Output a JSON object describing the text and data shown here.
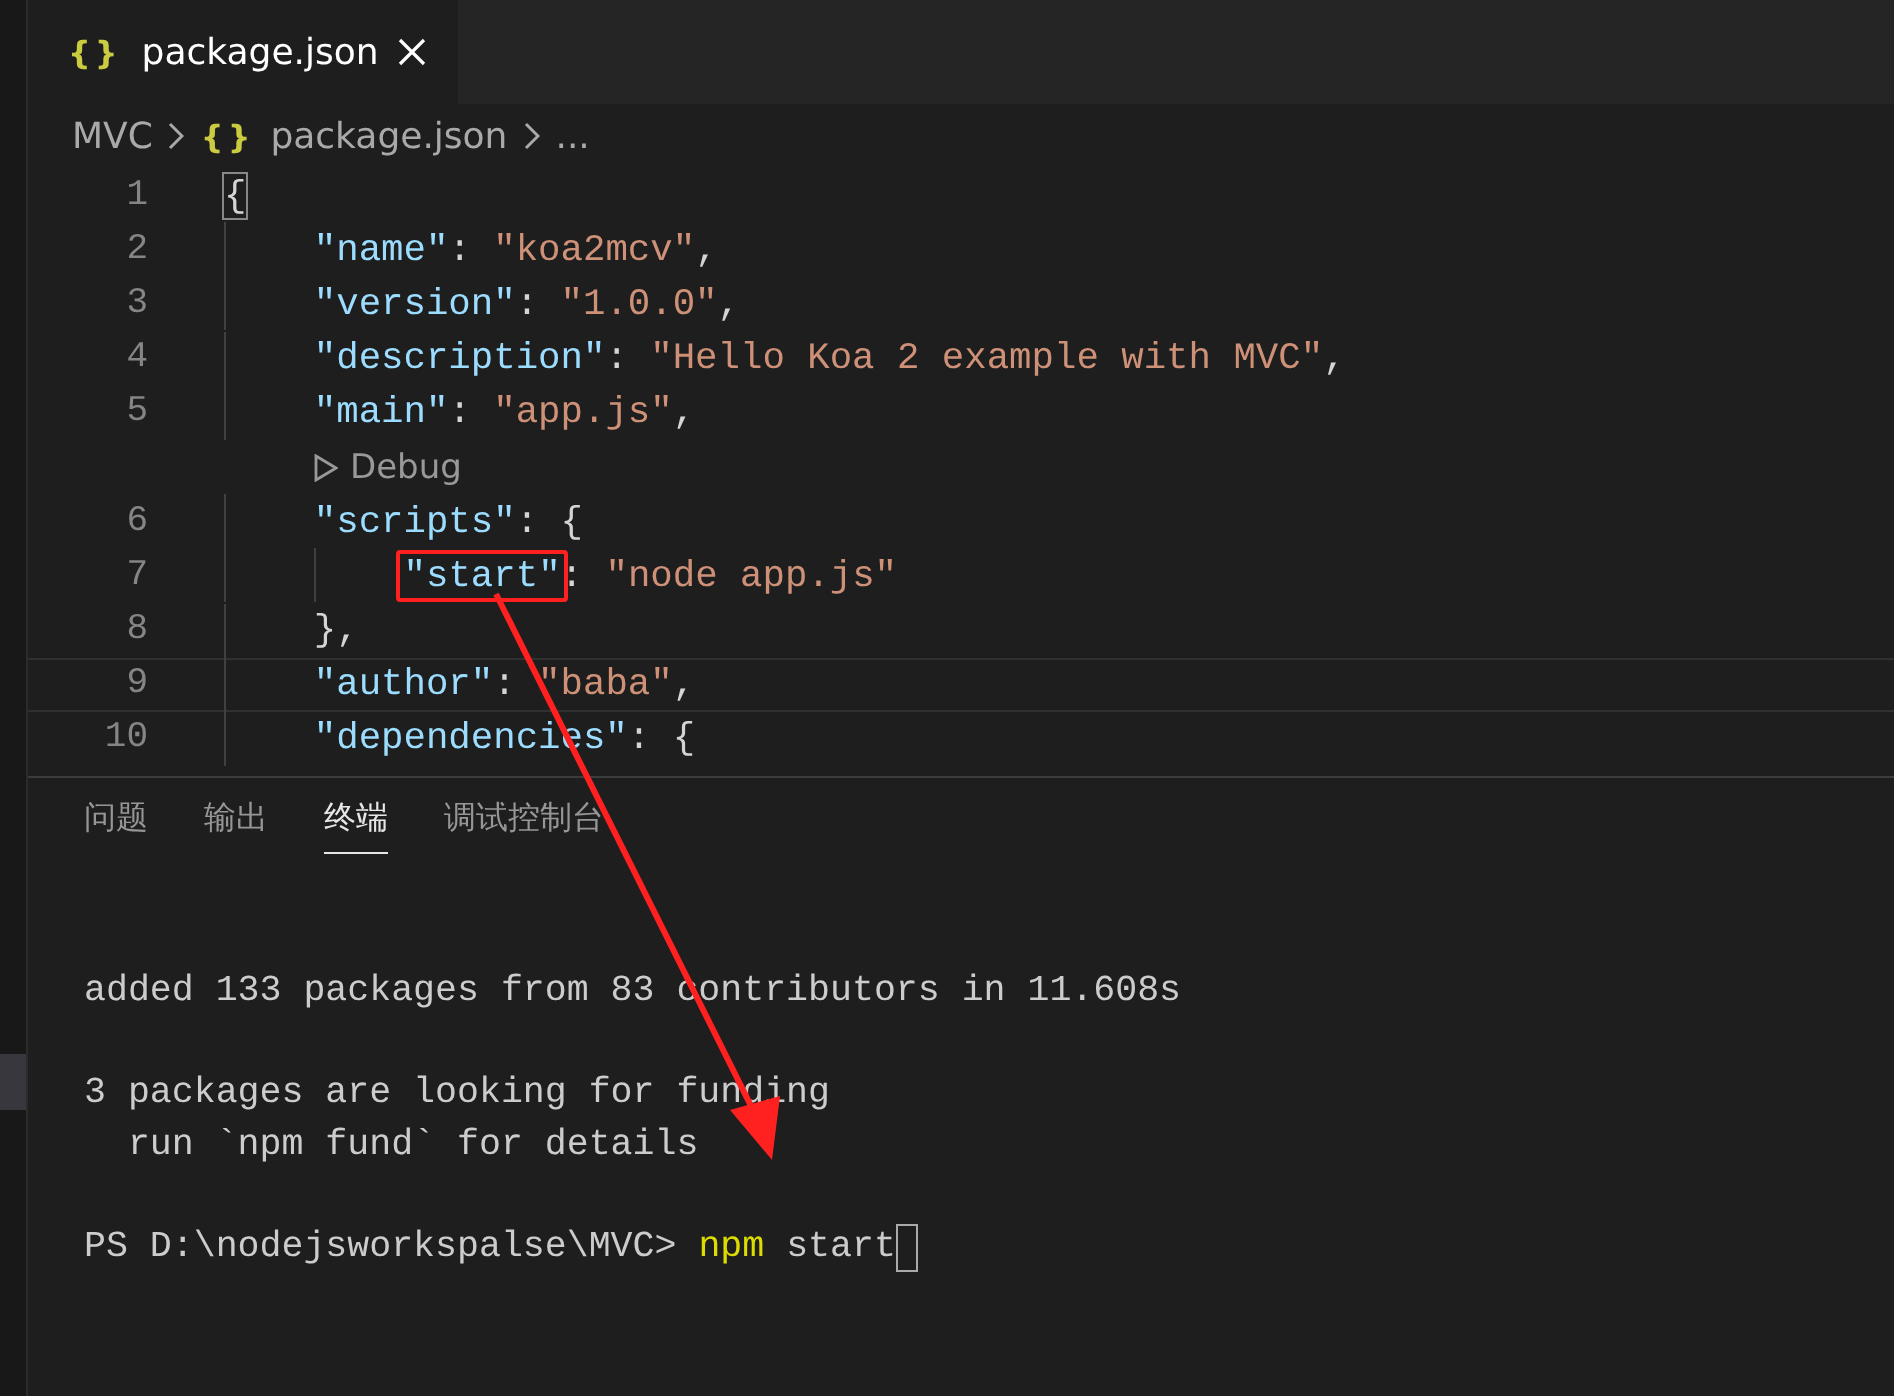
{
  "tabs": [
    {
      "label": "package.json",
      "icon": "{}",
      "selected": true
    }
  ],
  "breadcrumb": [
    {
      "label": "MVC"
    },
    {
      "label": "package.json",
      "icon": "{}"
    },
    {
      "label": "..."
    }
  ],
  "code_lines": [
    {
      "kind": "code",
      "number": "1",
      "current": false,
      "tokens": [
        {
          "kind": "bracket",
          "text": "{"
        }
      ],
      "children": [
        {
          "kind": "code",
          "number": "2",
          "current": false,
          "tokens": [
            {
              "kind": "key",
              "text": "\"name\""
            },
            {
              "kind": "punct",
              "text": ": "
            },
            {
              "kind": "string",
              "text": "\"koa2mcv\""
            },
            {
              "kind": "punct",
              "text": ","
            }
          ]
        },
        {
          "kind": "code",
          "number": "3",
          "current": false,
          "tokens": [
            {
              "kind": "key",
              "text": "\"version\""
            },
            {
              "kind": "punct",
              "text": ": "
            },
            {
              "kind": "string",
              "text": "\"1.0.0\""
            },
            {
              "kind": "punct",
              "text": ","
            }
          ]
        },
        {
          "kind": "code",
          "number": "4",
          "current": false,
          "tokens": [
            {
              "kind": "key",
              "text": "\"description\""
            },
            {
              "kind": "punct",
              "text": ": "
            },
            {
              "kind": "string",
              "text": "\"Hello Koa 2 example with MVC\""
            },
            {
              "kind": "punct",
              "text": ","
            }
          ]
        },
        {
          "kind": "code",
          "number": "5",
          "current": false,
          "tokens": [
            {
              "kind": "key",
              "text": "\"main\""
            },
            {
              "kind": "punct",
              "text": ": "
            },
            {
              "kind": "string",
              "text": "\"app.js\""
            },
            {
              "kind": "punct",
              "text": ","
            }
          ]
        },
        {
          "kind": "codelens",
          "label": "Debug"
        },
        {
          "kind": "code",
          "number": "6",
          "current": false,
          "tokens": [
            {
              "kind": "key",
              "text": "\"scripts\""
            },
            {
              "kind": "punct",
              "text": ": {"
            }
          ],
          "children": [
            {
              "kind": "code",
              "number": "7",
              "current": false,
              "tokens": [
                {
                  "kind": "key",
                  "text": "\"start\"",
                  "highlighted": true
                },
                {
                  "kind": "punct",
                  "text": ": "
                },
                {
                  "kind": "string",
                  "text": "\"node app.js\""
                }
              ]
            }
          ]
        },
        {
          "kind": "code",
          "number": "8",
          "current": false,
          "tokens": [
            {
              "kind": "punct",
              "text": "},"
            }
          ]
        },
        {
          "kind": "code",
          "number": "9",
          "current": true,
          "tokens": [
            {
              "kind": "key",
              "text": "\"author\""
            },
            {
              "kind": "punct",
              "text": ": "
            },
            {
              "kind": "string",
              "text": "\"baba\""
            },
            {
              "kind": "punct",
              "text": ","
            }
          ]
        },
        {
          "kind": "code",
          "number": "10",
          "current": false,
          "tokens": [
            {
              "kind": "key",
              "text": "\"dependencies\""
            },
            {
              "kind": "punct",
              "text": ": {"
            }
          ]
        }
      ]
    }
  ],
  "panel_tabs": [
    {
      "label": "问题",
      "selected": false
    },
    {
      "label": "输出",
      "selected": false
    },
    {
      "label": "终端",
      "selected": true
    },
    {
      "label": "调试控制台",
      "selected": false
    }
  ],
  "terminal_lines": [
    {
      "kind": "blank"
    },
    {
      "kind": "output",
      "text": "added 133 packages from 83 contributors in 11.608s"
    },
    {
      "kind": "blank"
    },
    {
      "kind": "output",
      "text": "3 packages are looking for funding"
    },
    {
      "kind": "output",
      "text": "  run `npm fund` for details"
    },
    {
      "kind": "blank"
    },
    {
      "kind": "prompt",
      "prompt": "PS D:\\nodejsworkspalse\\MVC> ",
      "command": "npm",
      "args": " start",
      "cursor": true
    }
  ]
}
